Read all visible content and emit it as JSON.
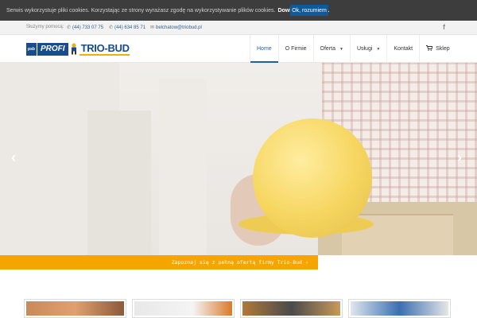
{
  "cookie": {
    "text": "Serwis wykorzystuje pliki cookies. Korzystając ze strony wyrażasz zgodę na wykorzystywanie plików cookies.",
    "link": "Dowiedz się więcej.",
    "button": "Ok, rozumiem"
  },
  "info_bar": {
    "help_label": "Służymy pomocą:",
    "phone1": "(44) 733 07 75",
    "phone2": "(44) 634 85 71",
    "email": "belchatow@triobud.pl",
    "social_icon": "facebook-icon"
  },
  "logo": {
    "psb": "psb",
    "profi": "PROFI",
    "brand": "TRIO-BUD"
  },
  "nav": {
    "items": [
      {
        "label": "Home",
        "active": true
      },
      {
        "label": "O Firmie"
      },
      {
        "label": "Oferta",
        "dropdown": true
      },
      {
        "label": "Usługi",
        "dropdown": true
      },
      {
        "label": "Kontakt"
      },
      {
        "label": "Sklep",
        "icon": "cart-icon"
      }
    ]
  },
  "hero": {
    "prev_icon": "chevron-left-icon",
    "next_icon": "chevron-right-icon"
  },
  "cta": {
    "label": "Zapoznaj się z pełną ofertą firmy Trio-Bud"
  },
  "colors": {
    "accent": "#1f5fa3",
    "cta_bg": "#f5a500",
    "cookie_btn": "#0f5a9b"
  }
}
